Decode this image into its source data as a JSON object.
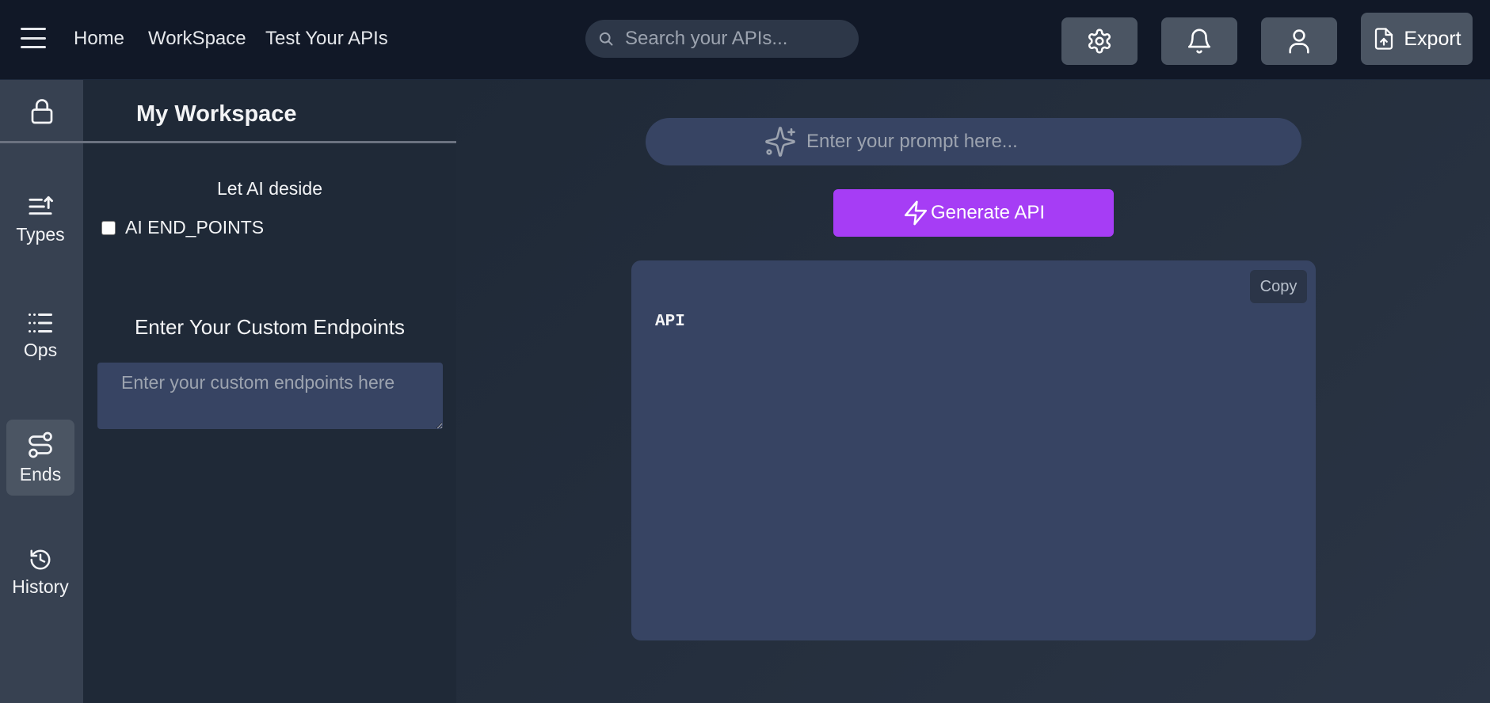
{
  "header": {
    "nav": [
      "Home",
      "WorkSpace",
      "Test Your APIs"
    ],
    "search_placeholder": "Search your APIs...",
    "export_label": "Export"
  },
  "rail": {
    "items": [
      {
        "label": "Types",
        "icon": "types-icon"
      },
      {
        "label": "Ops",
        "icon": "list-icon"
      },
      {
        "label": "Ends",
        "icon": "route-icon",
        "active": true
      },
      {
        "label": "History",
        "icon": "history-icon"
      }
    ]
  },
  "workspace": {
    "title": "My Workspace",
    "ai_decide_label": "Let AI deside",
    "ai_endpoints_label": "AI END_POINTS",
    "custom_endpoints_title": "Enter Your Custom Endpoints",
    "custom_endpoints_placeholder": "Enter your custom endpoints here"
  },
  "main": {
    "prompt_placeholder": "Enter your prompt here...",
    "generate_label": "Generate API",
    "copy_label": "Copy",
    "output_text": "API"
  },
  "colors": {
    "accent": "#a63df5",
    "topbar": "#111827",
    "rail": "#374151",
    "panel": "#1f2937",
    "input_bg": "#374463"
  }
}
